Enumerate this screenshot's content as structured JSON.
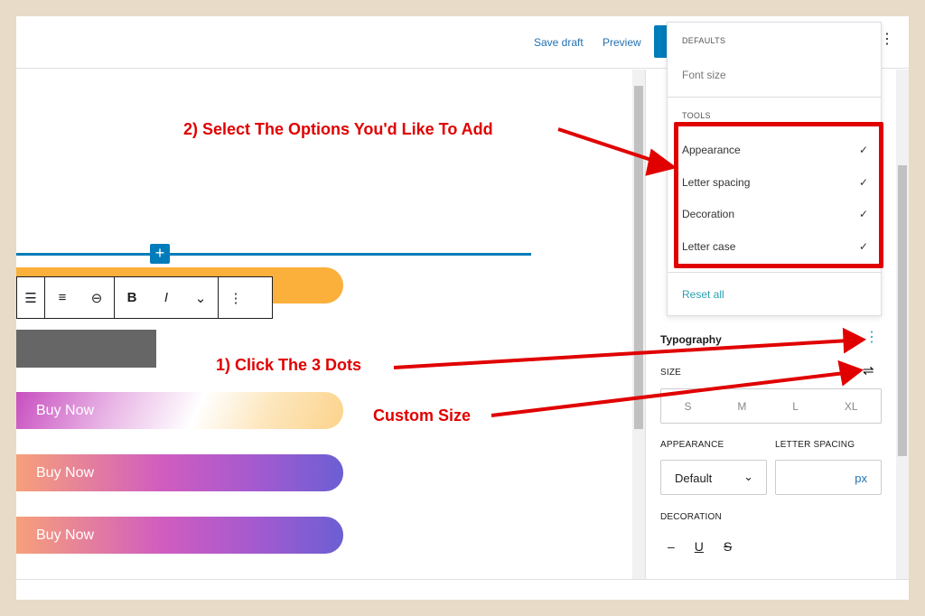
{
  "header": {
    "save_draft": "Save draft",
    "preview": "Preview",
    "more_icon": "vertical-ellipsis-icon"
  },
  "canvas": {
    "insert_icon": "plus-icon",
    "toolbar": {
      "icons": [
        "align-icon",
        "text-align-icon",
        "link-icon",
        "bold-icon",
        "italic-icon",
        "chevron-down-icon",
        "more-options-icon"
      ],
      "bold": "B",
      "italic": "I",
      "chevron": "⌄",
      "more": "⋮"
    },
    "buttons": [
      {
        "label": "Buy Now"
      },
      {
        "label": "Buy Now"
      },
      {
        "label": "Buy Now"
      }
    ],
    "colors": {
      "orange": "#fbb03b",
      "accent": "#007cba"
    }
  },
  "sidebar": {
    "typography": {
      "title": "Typography",
      "size_label": "SIZE",
      "sizes": [
        "S",
        "M",
        "L",
        "XL"
      ],
      "appearance_label": "APPEARANCE",
      "appearance_value": "Default",
      "letter_spacing_label": "LETTER SPACING",
      "letter_spacing_unit": "px",
      "decoration_label": "DECORATION",
      "decorations": [
        "–",
        "U",
        "S"
      ]
    }
  },
  "menu": {
    "defaults_heading": "DEFAULTS",
    "defaults": [
      "Font size"
    ],
    "tools_heading": "TOOLS",
    "tools": [
      {
        "label": "Appearance",
        "checked": true
      },
      {
        "label": "Letter spacing",
        "checked": true
      },
      {
        "label": "Decoration",
        "checked": true
      },
      {
        "label": "Letter case",
        "checked": true
      }
    ],
    "check": "✓",
    "reset": "Reset all"
  },
  "annotations": {
    "step2": "2) Select The Options You'd Like To Add",
    "step1": "1) Click The 3 Dots",
    "custom": "Custom Size",
    "color": "#e00000"
  }
}
